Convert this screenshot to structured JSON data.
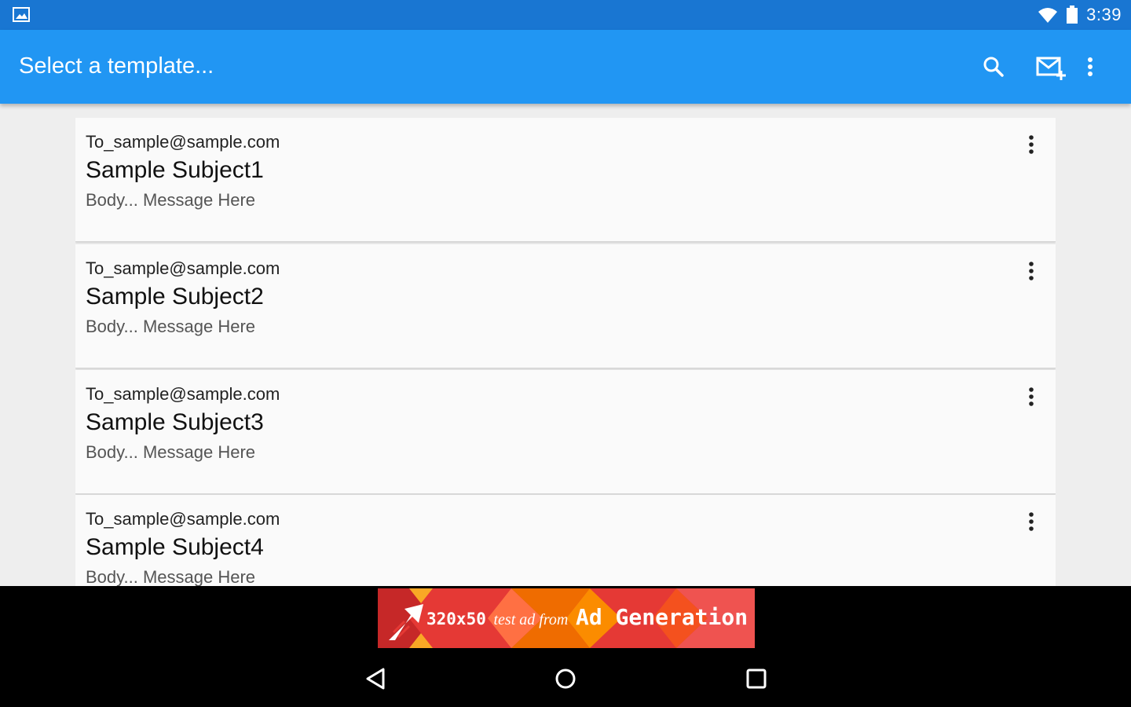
{
  "status_bar": {
    "time": "3:39",
    "icons": [
      "gallery-icon",
      "wifi-icon",
      "battery-icon"
    ]
  },
  "app_bar": {
    "title": "Select a template...",
    "actions": [
      "search-icon",
      "compose-mail-icon",
      "more-vert-icon"
    ]
  },
  "templates": [
    {
      "to": "To_sample@sample.com",
      "subject": "Sample Subject1",
      "body": "Body... Message Here"
    },
    {
      "to": "To_sample@sample.com",
      "subject": "Sample Subject2",
      "body": "Body... Message Here"
    },
    {
      "to": "To_sample@sample.com",
      "subject": "Sample Subject3",
      "body": "Body... Message Here"
    },
    {
      "to": "To_sample@sample.com",
      "subject": "Sample Subject4",
      "body": "Body... Message Here"
    }
  ],
  "ad": {
    "size_text": "320x50",
    "mid_text": "test ad from",
    "brand_text": "Ad Generation"
  },
  "nav_bar": {
    "buttons": [
      "back-icon",
      "home-icon",
      "recents-icon"
    ]
  },
  "colors": {
    "status_bar": "#1976d2",
    "app_bar": "#2196f3",
    "background": "#eeeeee",
    "card": "#fafafa"
  }
}
